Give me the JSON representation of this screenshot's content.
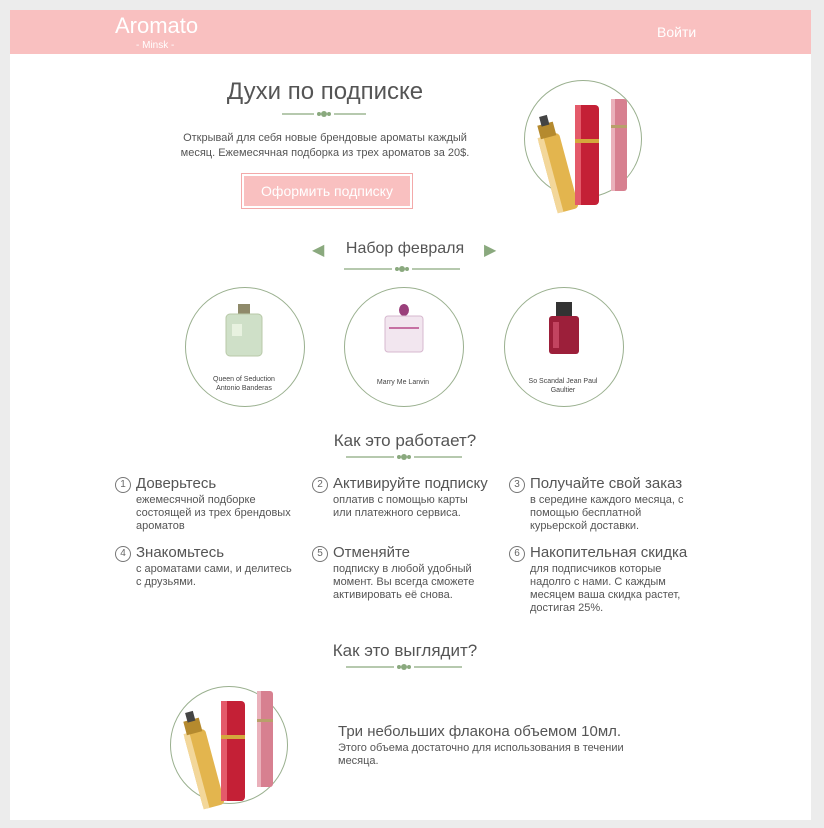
{
  "header": {
    "logo": "Aromato",
    "city": "- Minsk -",
    "login": "Войти"
  },
  "hero": {
    "title": "Духи по подписке",
    "text_line1": "Открывай для себя новые брендовые ароматы каждый",
    "text_line2": "месяц. Ежемесячная подборка из трех ароматов за 20$.",
    "button": "Оформить подписку"
  },
  "set": {
    "title": "Набор февраля",
    "products": [
      {
        "name_line1": "Queen of Seduction",
        "name_line2": "Antonio Banderas"
      },
      {
        "name_line1": "Marry Me Lanvin",
        "name_line2": ""
      },
      {
        "name_line1": "So Scandal Jean Paul",
        "name_line2": "Gaultier"
      }
    ]
  },
  "how": {
    "title": "Как это работает?",
    "steps": [
      {
        "num": "1",
        "title": "Доверьтесь",
        "lines": [
          "ежемесячной подборке",
          "состоящей из трех брендовых",
          "ароматов"
        ]
      },
      {
        "num": "2",
        "title": "Активируйте подписку",
        "lines": [
          "оплатив с помощью карты",
          "или платежного сервиса.",
          ""
        ]
      },
      {
        "num": "3",
        "title": "Получайте свой заказ",
        "lines": [
          "в середине каждого месяца, с",
          "помощью бесплатной",
          "курьерской доставки."
        ]
      },
      {
        "num": "4",
        "title": "Знакомьтесь",
        "lines": [
          "с ароматами сами, и делитесь",
          "с друзьями.",
          ""
        ]
      },
      {
        "num": "5",
        "title": "Отменяйте",
        "lines": [
          "подписку в любой удобный",
          "момент. Вы всегда сможете",
          "активировать её снова."
        ]
      },
      {
        "num": "6",
        "title": "Накопительная скидка",
        "lines": [
          "для подписчиков которые",
          "надолго с нами. С каждым",
          "месяцем ваша скидка растет,",
          "достигая 25%."
        ]
      }
    ]
  },
  "look": {
    "title": "Как это выглядит?",
    "headline": "Три небольших флакона объемом 10мл.",
    "text_line1": "Этого объема достаточно для использования в течении",
    "text_line2": "месяца."
  },
  "icons": {
    "prev": "chevron-left-icon",
    "next": "chevron-right-icon"
  },
  "colors": {
    "header": "#f9c0c0",
    "accent": "#8aa97e",
    "gold": "#e3b54e",
    "red": "#c42036",
    "pink": "#d78090"
  }
}
